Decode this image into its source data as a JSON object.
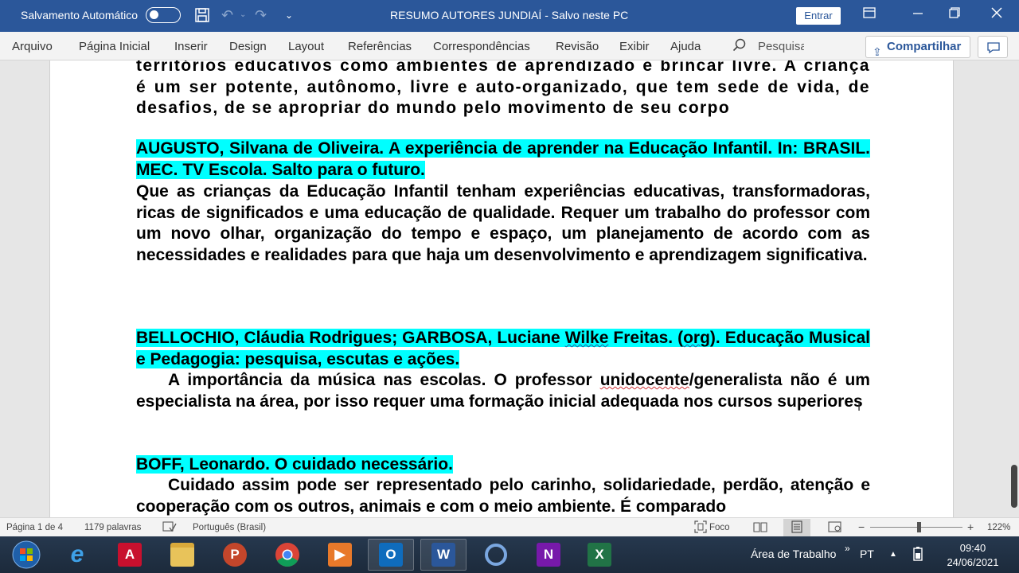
{
  "titlebar": {
    "autosave_label": "Salvamento Automático",
    "document_title": "RESUMO AUTORES JUNDIAÍ  -  Salvo neste PC",
    "signin_label": "Entrar"
  },
  "ribbon": {
    "tabs": [
      "Arquivo",
      "Página Inicial",
      "Inserir",
      "Design",
      "Layout",
      "Referências",
      "Correspondências",
      "Revisão",
      "Exibir",
      "Ajuda"
    ],
    "search_placeholder": "Pesquisa",
    "share_label": "Compartilhar"
  },
  "document": {
    "p0": "territórios educativos como ambientes de aprendizado e brincar livre. A criança é um ser potente, autônomo, livre e auto-organizado, que tem sede de vida, de desafios, de se apropriar do mundo pelo movimento de seu corpo",
    "ref1": "AUGUSTO, Silvana de Oliveira. A experiência de aprender na Educação Infantil. In: BRASIL. MEC. TV Escola. Salto para o futuro.",
    "p1": "Que as crianças da Educação Infantil tenham experiências educativas, transformadoras, ricas de significados e uma educação de qualidade. Requer um trabalho do professor com um novo olhar, organização do tempo e espaço, um planejamento de acordo com as necessidades e realidades para que haja um desenvolvimento e aprendizagem significativa.",
    "ref2_a": "BELLOCHIO, Cláudia Rodrigues; GARBOSA, Luciane ",
    "ref2_b": "Wilke",
    "ref2_c": " Freitas. (",
    "ref2_d": "org",
    "ref2_e": "). Educação Musical e Pedagogia: pesquisa, escutas e ações.",
    "p2_a": "A importância da música nas escolas. O professor ",
    "p2_b": "unidocente",
    "p2_c": "/generalista não é um especialista na área, por isso requer uma formação inicial adequada nos cursos superiores",
    "ref3": "BOFF, Leonardo. O cuidado necessário.",
    "p3": "Cuidado assim pode ser representado pelo carinho, solidariedade, perdão, atenção e cooperação com os outros, animais e com o meio ambiente. É comparado"
  },
  "statusbar": {
    "page": "Página 1 de 4",
    "words": "1179 palavras",
    "language": "Português (Brasil)",
    "focus": "Foco",
    "zoom": "122%"
  },
  "taskbar": {
    "desktop_label": "Área de Trabalho",
    "lang": "PT",
    "time": "09:40",
    "date": "24/06/2021"
  },
  "colors": {
    "word_blue": "#2b579a",
    "highlight": "#00ffff"
  },
  "icons": [
    "save-icon",
    "undo-icon",
    "redo-icon",
    "customize-icon",
    "ribbon-display-icon",
    "minimize-icon",
    "maximize-icon",
    "close-icon",
    "search-icon",
    "share-icon",
    "comment-icon"
  ]
}
